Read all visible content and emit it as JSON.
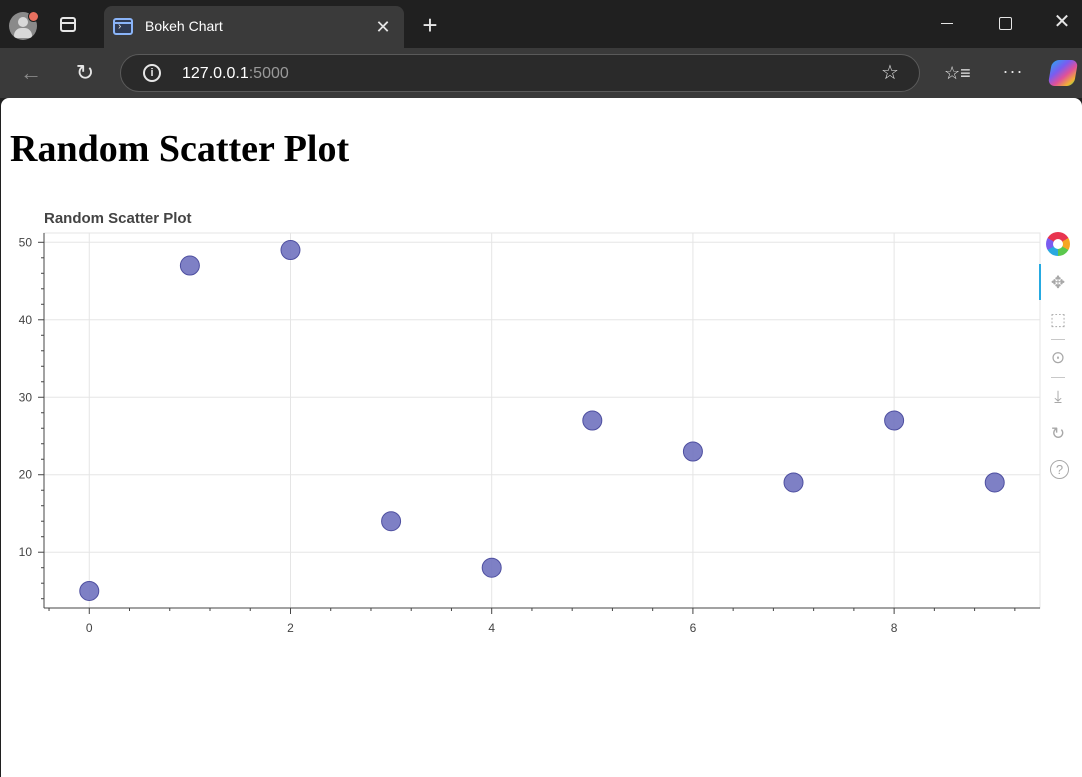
{
  "browser": {
    "tab_title": "Bokeh Chart",
    "url_host": "127.0.0.1",
    "url_port": ":5000",
    "tab_close_glyph": "✕",
    "new_tab_glyph": "+",
    "window_close_glyph": "✕",
    "back_glyph": "←",
    "refresh_glyph": "↻",
    "info_glyph": "i",
    "star_glyph": "☆",
    "favorites_glyph": "☆≡",
    "more_glyph": "···",
    "icons": [
      "profile-avatar-icon",
      "workspaces-icon",
      "page-favicon-icon",
      "close-icon",
      "plus-icon",
      "minimize-icon",
      "maximize-icon",
      "back-arrow-icon",
      "refresh-icon",
      "info-icon",
      "star-icon",
      "favorites-icon",
      "more-icon",
      "copilot-icon"
    ]
  },
  "page": {
    "heading": "Random Scatter Plot"
  },
  "toolbar_icons": {
    "pan": "✥",
    "box_zoom": "⬚",
    "wheel_zoom": "⊙",
    "save": "⤓",
    "reset": "↻",
    "help": "?"
  },
  "chart_data": {
    "type": "scatter",
    "title": "Random Scatter Plot",
    "xlabel": "",
    "ylabel": "",
    "x": [
      0,
      1,
      2,
      3,
      4,
      5,
      6,
      7,
      8,
      9
    ],
    "y": [
      5,
      47,
      49,
      14,
      8,
      27,
      23,
      19,
      27,
      19
    ],
    "xlim": [
      -0.45,
      9.45
    ],
    "ylim": [
      2.8,
      51.2
    ],
    "x_ticks": [
      0,
      2,
      4,
      6,
      8
    ],
    "y_ticks": [
      10,
      20,
      30,
      40,
      50
    ],
    "grid": true,
    "legend": "none",
    "marker_color": "#7072bf",
    "marker_edge_color": "#4e4fa0",
    "grid_color": "#e5e5e5",
    "axis_color": "#444444"
  }
}
